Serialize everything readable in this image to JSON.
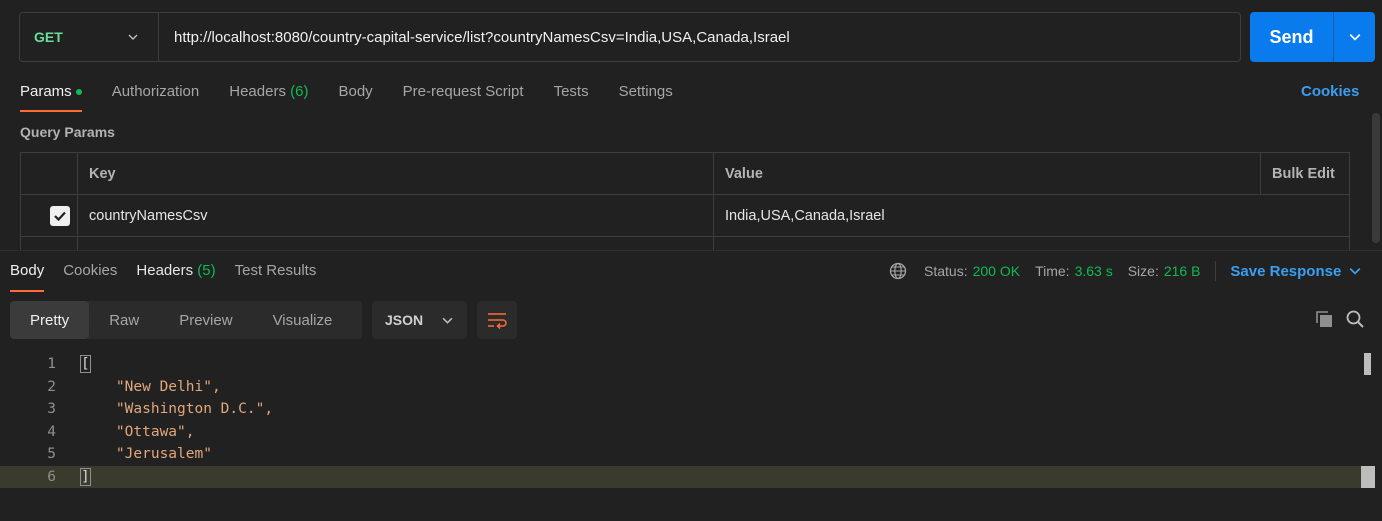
{
  "request": {
    "method": "GET",
    "url": "http://localhost:8080/country-capital-service/list?countryNamesCsv=India,USA,Canada,Israel",
    "send_label": "Send"
  },
  "request_tabs": [
    {
      "label": "Params",
      "active": true
    },
    {
      "label": "Authorization"
    },
    {
      "label": "Headers",
      "count": "(6)"
    },
    {
      "label": "Body"
    },
    {
      "label": "Pre-request Script"
    },
    {
      "label": "Tests"
    },
    {
      "label": "Settings"
    }
  ],
  "cookies_label": "Cookies",
  "query_params": {
    "title": "Query Params",
    "headers": {
      "key": "Key",
      "value": "Value",
      "bulk_edit": "Bulk Edit"
    },
    "rows": [
      {
        "checked": true,
        "key": "countryNamesCsv",
        "value": "India,USA,Canada,Israel"
      }
    ]
  },
  "response_tabs": [
    {
      "label": "Body",
      "active": true
    },
    {
      "label": "Cookies"
    },
    {
      "label": "Headers",
      "count": "(5)"
    },
    {
      "label": "Test Results"
    }
  ],
  "response_meta": {
    "status_label": "Status:",
    "status_value": "200 OK",
    "time_label": "Time:",
    "time_value": "3.63 s",
    "size_label": "Size:",
    "size_value": "216 B",
    "save_label": "Save Response"
  },
  "view_modes": [
    "Pretty",
    "Raw",
    "Preview",
    "Visualize"
  ],
  "format": "JSON",
  "code_lines": [
    {
      "n": "1",
      "text": "["
    },
    {
      "n": "2",
      "text": "    \"New Delhi\","
    },
    {
      "n": "3",
      "text": "    \"Washington D.C.\","
    },
    {
      "n": "4",
      "text": "    \"Ottawa\","
    },
    {
      "n": "5",
      "text": "    \"Jerusalem\""
    },
    {
      "n": "6",
      "text": "]"
    }
  ],
  "colors": {
    "accent": "#ff6c37",
    "send": "#097bed",
    "success": "#0cbb52",
    "link": "#3a9ff2"
  }
}
